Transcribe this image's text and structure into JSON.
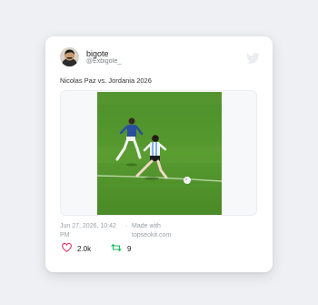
{
  "tweet": {
    "author_name": "bigote",
    "author_handle": "@Exbigote_",
    "text": "Nicolas Paz vs. Jordania 2026",
    "date": "Jun 27, 2026, 10:42 PM",
    "separator": "·",
    "made_with": "Made with topseokit.com",
    "likes": "2.0k",
    "retweets": "9"
  },
  "colors": {
    "like": "#e0245e",
    "retweet": "#17bf63",
    "brand_bird": "#eef0f4"
  },
  "icons": {
    "brand": "twitter-bird-icon",
    "like": "heart-icon",
    "retweet": "retweet-icon"
  }
}
